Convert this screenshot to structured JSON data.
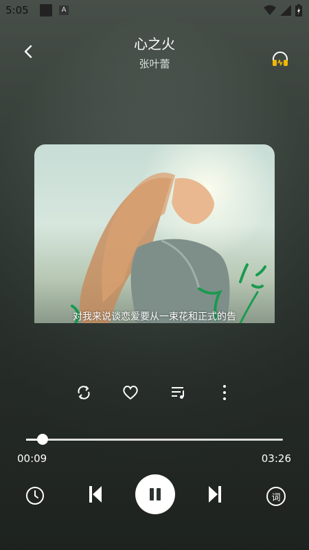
{
  "status_bar": {
    "time": "5:05",
    "badge": "A"
  },
  "header": {
    "title": "心之火",
    "artist": "张叶蕾"
  },
  "album": {
    "lyric": "对我来说谈恋爱要从一束花和正式的告"
  },
  "progress": {
    "current": "00:09",
    "total": "03:26",
    "fraction": 0.064
  },
  "controls": {
    "lyric_button": "词"
  },
  "colors": {
    "accent": "#ffffff",
    "headphone": "#f2b705"
  }
}
